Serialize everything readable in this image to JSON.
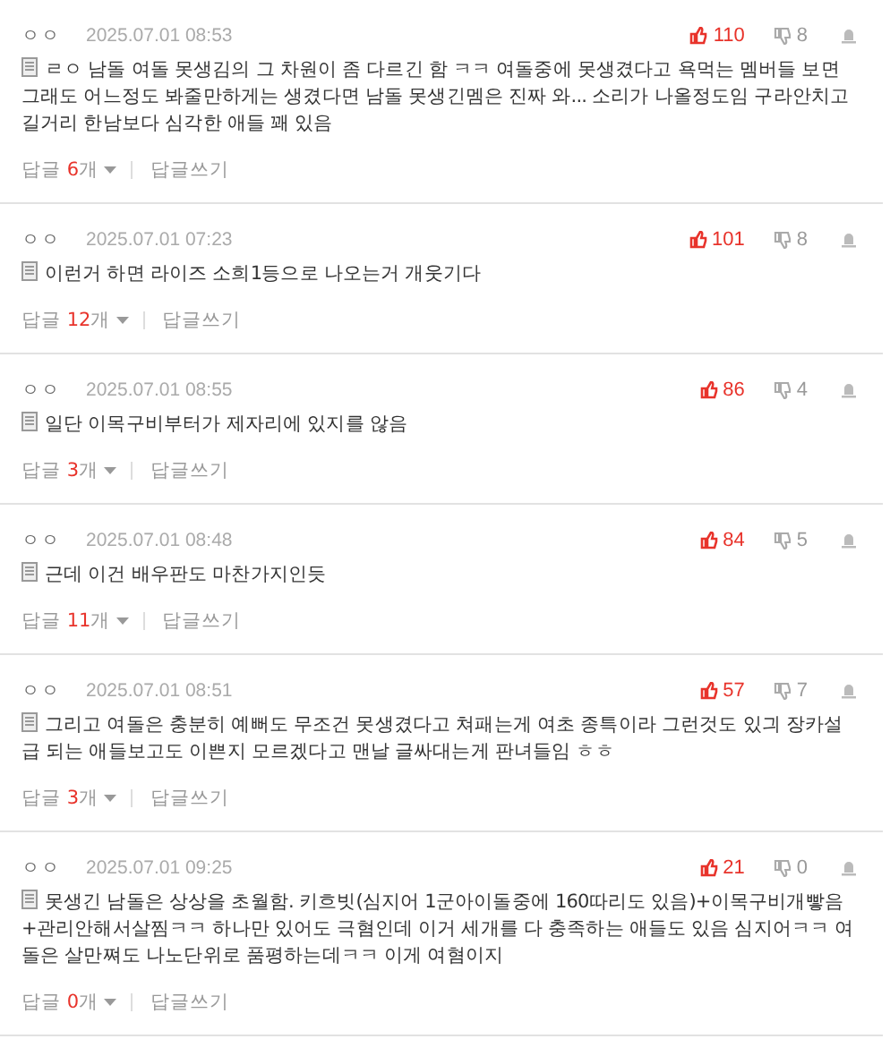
{
  "comments": [
    {
      "author": "ㅇㅇ",
      "date": "2025.07.01 08:53",
      "likes": "110",
      "dislikes": "8",
      "text": "ㄹㅇ 남돌 여돌 못생김의 그 차원이 좀 다르긴 함 ㅋㅋ 여돌중에 못생겼다고 욕먹는 멤버들 보면 그래도 어느정도 봐줄만하게는 생겼다면 남돌 못생긴멤은 진짜 와... 소리가 나올정도임 구라안치고 길거리 한남보다 심각한 애들 꽤 있음",
      "reply_label": "답글",
      "reply_count": "6",
      "reply_unit": "개",
      "write_label": "답글쓰기"
    },
    {
      "author": "ㅇㅇ",
      "date": "2025.07.01 07:23",
      "likes": "101",
      "dislikes": "8",
      "text": "이런거 하면 라이즈 소희1등으로 나오는거 개웃기다",
      "reply_label": "답글",
      "reply_count": "12",
      "reply_unit": "개",
      "write_label": "답글쓰기"
    },
    {
      "author": "ㅇㅇ",
      "date": "2025.07.01 08:55",
      "likes": "86",
      "dislikes": "4",
      "text": "일단 이목구비부터가 제자리에 있지를 않음",
      "reply_label": "답글",
      "reply_count": "3",
      "reply_unit": "개",
      "write_label": "답글쓰기"
    },
    {
      "author": "ㅇㅇ",
      "date": "2025.07.01 08:48",
      "likes": "84",
      "dislikes": "5",
      "text": "근데 이건 배우판도 마찬가지인듯",
      "reply_label": "답글",
      "reply_count": "11",
      "reply_unit": "개",
      "write_label": "답글쓰기"
    },
    {
      "author": "ㅇㅇ",
      "date": "2025.07.01 08:51",
      "likes": "57",
      "dislikes": "7",
      "text": "그리고 여돌은 충분히 예뻐도 무조건 못생겼다고 쳐패는게 여초 종특이라 그런것도 있긔 장카설 급 되는 애들보고도 이쁜지 모르겠다고 맨날 글싸대는게 판녀들임 ㅎㅎ",
      "reply_label": "답글",
      "reply_count": "3",
      "reply_unit": "개",
      "write_label": "답글쓰기"
    },
    {
      "author": "ㅇㅇ",
      "date": "2025.07.01 09:25",
      "likes": "21",
      "dislikes": "0",
      "text": "못생긴 남돌은 상상을 초월함. 키흐빗(심지어 1군아이돌중에 160따리도 있음)+이목구비개빻음+관리안해서살찜ㅋㅋ 하나만 있어도 극혐인데 이거 세개를 다 충족하는 애들도 있음 심지어ㅋㅋ 여돌은 살만쪄도 나노단위로 품평하는데ㅋㅋ 이게 여혐이지",
      "reply_label": "답글",
      "reply_count": "0",
      "reply_unit": "개",
      "write_label": "답글쓰기"
    }
  ]
}
